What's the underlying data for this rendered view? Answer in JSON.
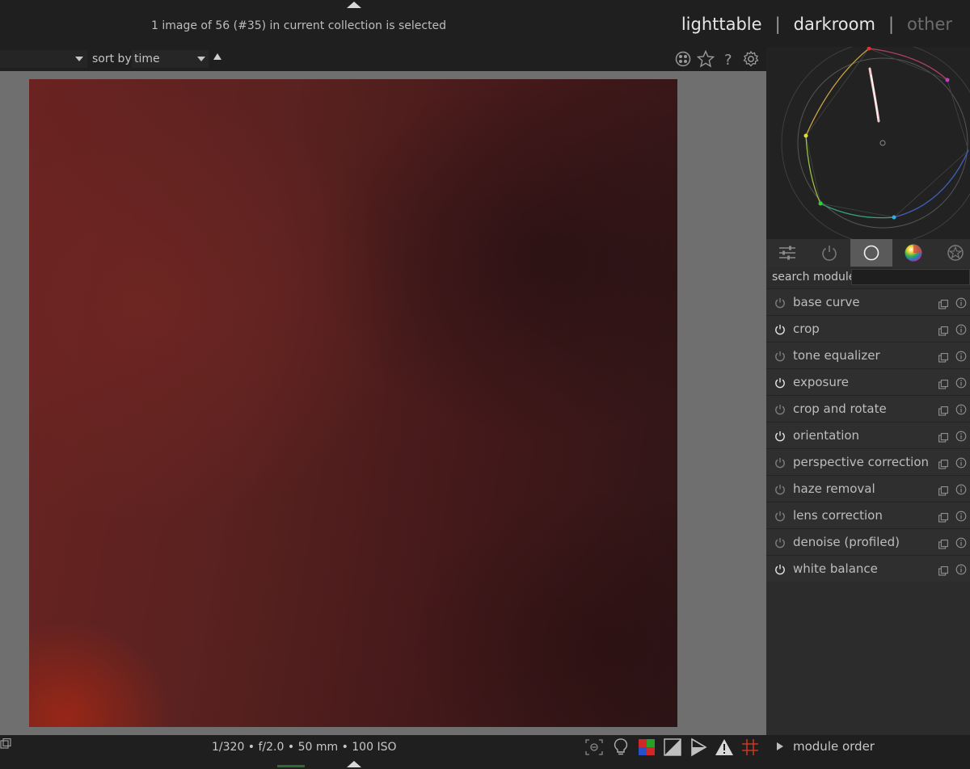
{
  "header": {
    "collection_info": "1 image of 56 (#35) in current collection is selected",
    "views": {
      "lighttable": "lighttable",
      "separator": "|",
      "darkroom": "darkroom",
      "other": "other"
    }
  },
  "toolbar": {
    "sort_label": "sort by",
    "sort_value": "time"
  },
  "toolbar_icons": [
    "color-labels-icon",
    "star-icon",
    "help-icon",
    "gear-icon"
  ],
  "module_tabs": [
    "sliders-icon",
    "power-icon",
    "circle-icon",
    "color-wheel-icon",
    "effects-icon"
  ],
  "search": {
    "label": "search module",
    "value": ""
  },
  "modules": [
    {
      "name": "base curve",
      "enabled": false
    },
    {
      "name": "crop",
      "enabled": true
    },
    {
      "name": "tone equalizer",
      "enabled": false
    },
    {
      "name": "exposure",
      "enabled": true
    },
    {
      "name": "crop and rotate",
      "enabled": false
    },
    {
      "name": "orientation",
      "enabled": true
    },
    {
      "name": "perspective correction",
      "enabled": false
    },
    {
      "name": "haze removal",
      "enabled": false
    },
    {
      "name": "lens correction",
      "enabled": false
    },
    {
      "name": "denoise (profiled)",
      "enabled": false
    },
    {
      "name": "white balance",
      "enabled": true
    }
  ],
  "exif": "1/320 • f/2.0 • 50 mm • 100 ISO",
  "bottom_icons": [
    "focus-peaking-icon",
    "bulb-icon",
    "color-assessment-icon",
    "softproof-icon",
    "gamut-check-icon",
    "overexposed-warning-icon",
    "guides-icon"
  ],
  "module_order": {
    "label": "module order"
  },
  "colors": {
    "accent_red": "#c8361e",
    "panel_bg": "#2f2f2f",
    "canvas_bg": "#6f6f6f"
  }
}
